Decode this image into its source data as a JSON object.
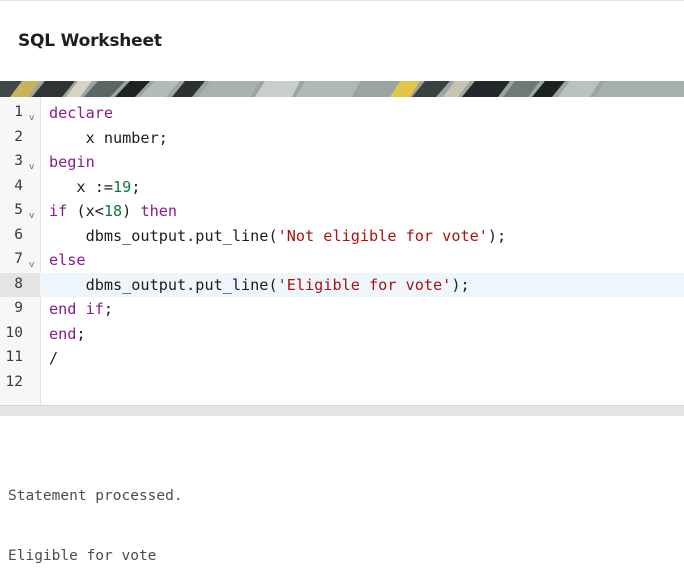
{
  "page": {
    "title": "SQL Worksheet"
  },
  "editor": {
    "lines": [
      {
        "number": "1",
        "fold": "v",
        "tokens": [
          {
            "text": "declare",
            "cls": "kw"
          }
        ]
      },
      {
        "number": "2",
        "fold": "",
        "tokens": [
          {
            "text": "    x number;",
            "cls": ""
          }
        ]
      },
      {
        "number": "3",
        "fold": "v",
        "tokens": [
          {
            "text": "begin",
            "cls": "kw"
          }
        ]
      },
      {
        "number": "4",
        "fold": "",
        "tokens": [
          {
            "text": "   x :=",
            "cls": ""
          },
          {
            "text": "19",
            "cls": "numlit"
          },
          {
            "text": ";",
            "cls": ""
          }
        ]
      },
      {
        "number": "5",
        "fold": "v",
        "tokens": [
          {
            "text": "if",
            "cls": "kw"
          },
          {
            "text": " (x<",
            "cls": ""
          },
          {
            "text": "18",
            "cls": "numlit"
          },
          {
            "text": ") ",
            "cls": ""
          },
          {
            "text": "then",
            "cls": "kw"
          }
        ]
      },
      {
        "number": "6",
        "fold": "",
        "tokens": [
          {
            "text": "    dbms_output.put_line(",
            "cls": ""
          },
          {
            "text": "'Not eligible for vote'",
            "cls": "str"
          },
          {
            "text": ");",
            "cls": ""
          }
        ]
      },
      {
        "number": "7",
        "fold": "v",
        "tokens": [
          {
            "text": "else",
            "cls": "kw"
          }
        ]
      },
      {
        "number": "8",
        "fold": "",
        "active": true,
        "tokens": [
          {
            "text": "    dbms_output.put_line(",
            "cls": ""
          },
          {
            "text": "'Eligible for vote'",
            "cls": "str"
          },
          {
            "text": ");",
            "cls": ""
          }
        ]
      },
      {
        "number": "9",
        "fold": "",
        "tokens": [
          {
            "text": "end",
            "cls": "kw"
          },
          {
            "text": " ",
            "cls": ""
          },
          {
            "text": "if",
            "cls": "kw"
          },
          {
            "text": ";",
            "cls": ""
          }
        ]
      },
      {
        "number": "10",
        "fold": "",
        "tokens": [
          {
            "text": "end",
            "cls": "kw"
          },
          {
            "text": ";",
            "cls": ""
          }
        ]
      },
      {
        "number": "11",
        "fold": "",
        "tokens": [
          {
            "text": "/",
            "cls": ""
          }
        ]
      },
      {
        "number": "12",
        "fold": "",
        "tokens": []
      }
    ]
  },
  "output": {
    "lines": [
      "Statement processed.",
      "Eligible for vote"
    ]
  },
  "colors": {
    "keyword": "#8b1a8b",
    "number": "#0b7a3b",
    "string": "#a3150e",
    "active_line": "#eef6fc"
  }
}
